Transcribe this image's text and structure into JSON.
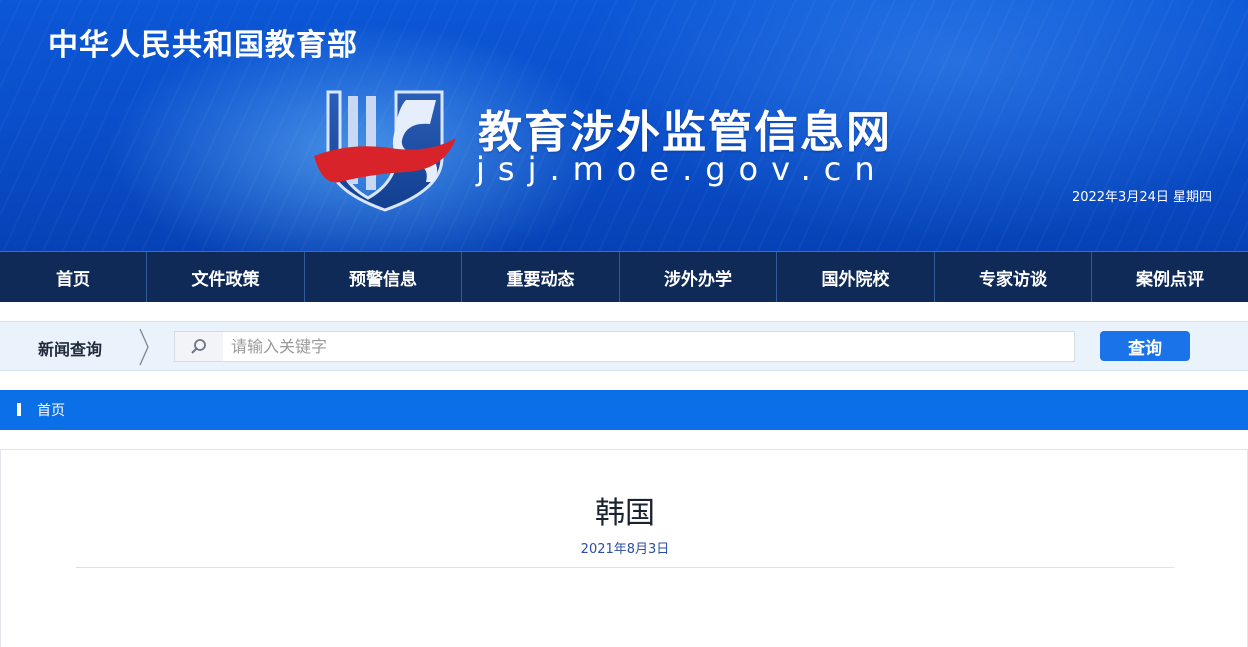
{
  "header": {
    "ministry": "中华人民共和国教育部",
    "site_title": "教育涉外监管信息网",
    "site_domain": "jsj.moe.gov.cn",
    "date": "2022年3月24日  星期四"
  },
  "nav": {
    "items": [
      {
        "label": "首页"
      },
      {
        "label": "文件政策"
      },
      {
        "label": "预警信息"
      },
      {
        "label": "重要动态"
      },
      {
        "label": "涉外办学"
      },
      {
        "label": "国外院校"
      },
      {
        "label": "专家访谈"
      },
      {
        "label": "案例点评"
      }
    ]
  },
  "search": {
    "label": "新闻查询",
    "placeholder": "请输入关键字",
    "button_label": "查询"
  },
  "breadcrumb": {
    "home": "首页"
  },
  "article": {
    "title": "韩国",
    "date": "2021年8月3日"
  },
  "colors": {
    "banner_blue": "#0b57d6",
    "nav_bg": "#0f2a56",
    "breadcrumb_bg": "#0b6fe8",
    "button_blue": "#1a73e8",
    "logo_red": "#d8232a"
  }
}
